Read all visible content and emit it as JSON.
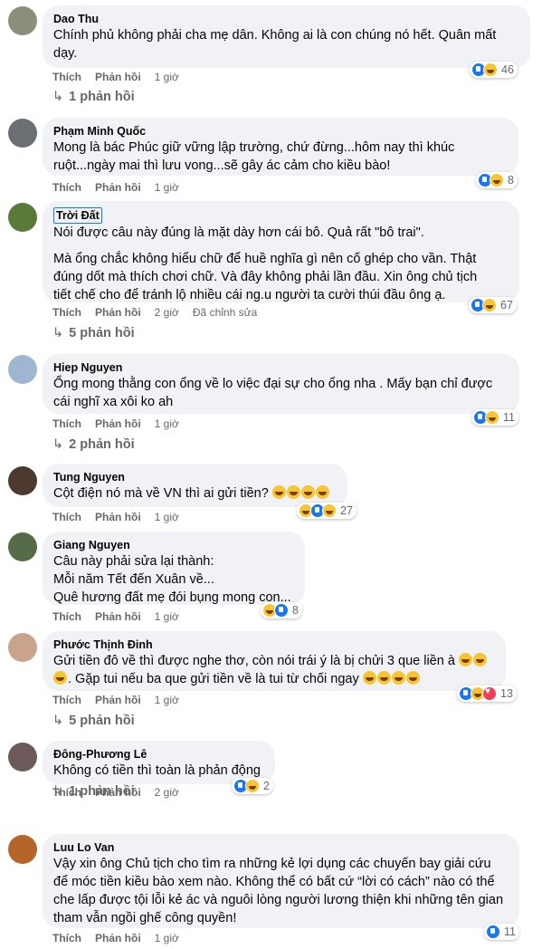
{
  "labels": {
    "like": "Thích",
    "reply": "Phản hồi"
  },
  "comments": [
    {
      "author": "Dao Thu",
      "lines": [
        "Chính phủ không phải cha mẹ dân. Không ai là con chúng nó hết. Quân mất",
        "dạy."
      ],
      "time": "1 giờ",
      "reactions": "46",
      "replies": "1 phản hồi"
    },
    {
      "author": "Phạm Minh Quốc",
      "lines": [
        "Mong là bác Phúc giữ vững lập trường, chứ đừng...hôm nay thì khúc",
        "ruột...ngày mai thì lưu vong...sẽ gây ác cảm cho kiều bào!"
      ],
      "time": "1 giờ",
      "reactions": "8"
    },
    {
      "author": "Trời Đất",
      "p1": "Nói được câu này đúng là mặt dày hơn cái bô. Quả rất \"bô trai\".",
      "p2": [
        "Mà ổng chắc không hiểu chữ để huề nghĩa gì nên cố ghép cho vần. Thật",
        "đúng dốt mà thích chơi chữ. Và đây không phải lần đầu. Xin ông chủ tịch",
        "tiết chế cho để tránh lộ nhiều cái ng.u người ta cười thúi đầu ông ạ."
      ],
      "time": "2 giờ",
      "edited": "Đã chỉnh sửa",
      "reactions": "67",
      "replies": "5 phản hồi"
    },
    {
      "author": "Hiep Nguyen",
      "lines": [
        "Ổng mong thằng con ổng về lo việc đại sự cho ổng nha . Mấy bạn chỉ được",
        "cái nghĩ xa xôi ko ah"
      ],
      "time": "1 giờ",
      "reactions": "11",
      "replies": "2 phản hồi"
    },
    {
      "author": "Tung Nguyen",
      "lines": [
        "Cột điện nó mà về VN thì ai gửi tiền?"
      ],
      "time": "1 giờ",
      "reactions": "27"
    },
    {
      "author": "Giang Nguyen",
      "lines": [
        "Câu này phải sửa lại thành:",
        "Mỗi năm Tết đến Xuân về...",
        "Quê hương đất mẹ đói bụng mong con..."
      ],
      "time": "1 giờ",
      "reactions": "8"
    },
    {
      "author": "Phước Thịnh Đinh",
      "lines": [
        "Gửi tiền đô về thì được nghe thơ, còn nói trái ý là bị chửi 3 que liền à",
        ". Gặp tui nếu ba que gửi tiền về là tui từ chối ngay"
      ],
      "time": "1 giờ",
      "reactions": "13",
      "replies": "5 phản hồi"
    },
    {
      "author": "Đông-Phương Lê",
      "lines": [
        "Không có tiền thì toàn là phản động"
      ],
      "time": "2 giờ",
      "reactions": "2",
      "replies": "1 phản hồi"
    },
    {
      "author": "Luu Lo Van",
      "lines": [
        "Vậy xin ông Chủ tịch cho tìm ra những kẻ lợi dụng các chuyến bay giải cứu",
        "để móc tiền kiều bào xem nào. Không thể có bất cứ “lời có cách” nào có thể",
        "che lấp được tội lỗi kẻ ác và nguôi lòng người lương thiện khi những tên gian",
        "tham vẫn ngồi ghế công quyền!"
      ],
      "time": "1 giờ",
      "reactions": "11"
    }
  ]
}
